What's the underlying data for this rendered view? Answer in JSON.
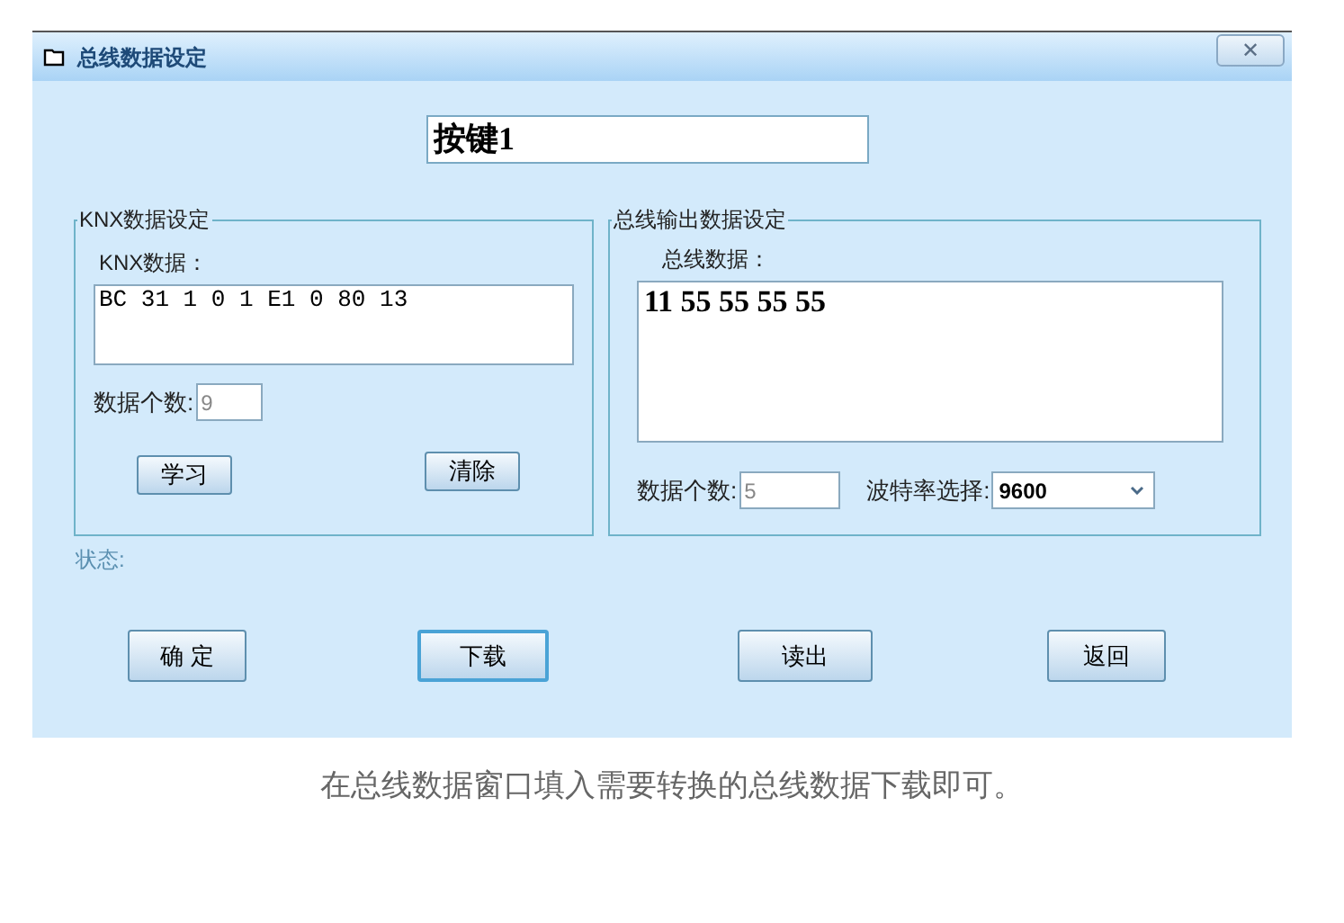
{
  "window": {
    "title": "总线数据设定",
    "close": "✕"
  },
  "name_field": {
    "value": "按键1"
  },
  "knx_group": {
    "title": "KNX数据设定",
    "data_label": "KNX数据：",
    "data": "BC 31 1 0 1 E1 0 80 13",
    "count_label": "数据个数:",
    "count": "9",
    "buttons": [
      {
        "label": "学习"
      },
      {
        "label": "清除"
      }
    ]
  },
  "bus_group": {
    "title": "总线输出数据设定",
    "data_label": "总线数据：",
    "data": "11 55 55 55 55 ",
    "count_label": "数据个数:",
    "count": "5",
    "baud_label": "波特率选择:",
    "baud": "9600"
  },
  "status_label": "状态:",
  "buttons": [
    {
      "label": "确 定",
      "focused": false
    },
    {
      "label": "下载",
      "focused": true
    },
    {
      "label": "读出",
      "focused": false
    },
    {
      "label": "返回",
      "focused": false
    }
  ],
  "caption": "在总线数据窗口填入需要转换的总线数据下载即可。"
}
